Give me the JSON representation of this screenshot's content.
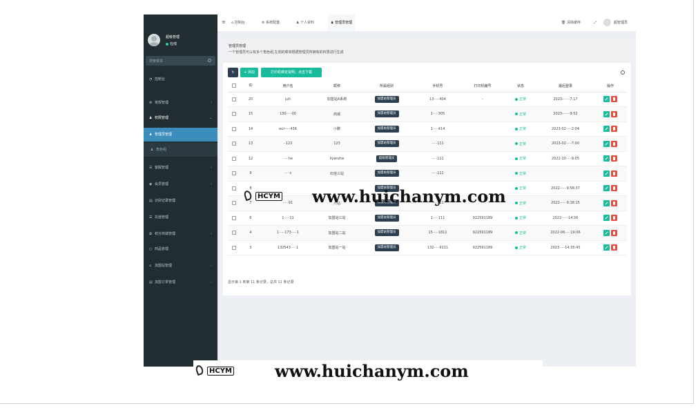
{
  "sidebar": {
    "user_name": "超级管理",
    "online": "在线",
    "search_placeholder": "搜索菜单",
    "items": [
      {
        "label": "控制台",
        "icon": "dashboard-icon",
        "expandable": false
      },
      {
        "label": "常规管理",
        "icon": "cogs-icon",
        "expandable": true
      },
      {
        "label": "权限管理",
        "icon": "group-icon",
        "expandable": true,
        "open": true
      },
      {
        "label": "管理员管理",
        "icon": "user-icon",
        "active": true
      },
      {
        "label": "角色组",
        "icon": "group-icon",
        "sub": true
      },
      {
        "label": "客服管理",
        "icon": "list-icon",
        "expandable": true
      },
      {
        "label": "会员管理",
        "icon": "user-circle-icon",
        "expandable": true
      },
      {
        "label": "识别记录管理",
        "icon": "list-alt-icon",
        "expandable": false
      },
      {
        "label": "充值管理",
        "icon": "list-icon",
        "expandable": false
      },
      {
        "label": "积分商城管理",
        "icon": "gift-icon",
        "expandable": true
      },
      {
        "label": "商品管理",
        "icon": "circle-icon",
        "expandable": false
      },
      {
        "label": "加盟站管理",
        "icon": "bank-icon",
        "expandable": true
      },
      {
        "label": "加盟订单管理",
        "icon": "list-alt-icon",
        "expandable": true
      }
    ]
  },
  "topbar": {
    "tabs": [
      "控制台",
      "系统配置",
      "个人资料",
      "管理员管理"
    ],
    "clear_cache": "清除缓存",
    "admin_name": "超管理员"
  },
  "content": {
    "title": "管理员管理",
    "description": "一个管理员可以有多个角色组,左侧的菜单根据管理员所拥有的权限进行生成",
    "btn_add": "添加",
    "btn_print": "打印机绑定说明，点击下载",
    "columns": [
      "ID",
      "用户名",
      "昵称",
      "所属组别",
      "手机号",
      "打印机编号",
      "状态",
      "最后登录",
      "操作"
    ],
    "rows": [
      {
        "id": "20",
        "username": "juh",
        "nickname": "加盟站A系统",
        "group": "加盟站管理员",
        "phone": "13·····404",
        "printer": "-",
        "status": "正常",
        "last_login": "2023-······7:17"
      },
      {
        "id": "15",
        "username": "130·····00",
        "nickname": "商城",
        "group": "加盟站管理员",
        "phone": "1·····305",
        "printer": "",
        "status": "正常",
        "last_login": "2023-······9:52"
      },
      {
        "id": "14",
        "username": "eur·····436",
        "nickname": "小鹏",
        "group": "加盟站管理员",
        "phone": "1·····414",
        "printer": "",
        "status": "正常",
        "last_login": "2023-02·····2:04"
      },
      {
        "id": "13",
        "username": "··123",
        "nickname": "123",
        "group": "加盟站管理员",
        "phone": "·····111",
        "printer": "",
        "status": "正常",
        "last_login": "2023-02·····7:00"
      },
      {
        "id": "12",
        "username": "·····he",
        "nickname": "liyanzhe",
        "group": "超级管理员",
        "phone": "·····111",
        "printer": "",
        "status": "正常",
        "last_login": "2022-10·····9:05"
      },
      {
        "id": "9",
        "username": "·····s",
        "nickname": "石佳三站",
        "group": "加盟站管理员",
        "phone": "·····111",
        "printer": "",
        "status": "正常",
        "last_login": ""
      },
      {
        "id": "8",
        "username": "",
        "nickname": "",
        "group": "加盟站管理员",
        "phone": "",
        "printer": "",
        "status": "正常",
        "last_login": "2022-·····9:58:37"
      },
      {
        "id": "7",
        "username": "·····91",
        "nickname": "六站",
        "group": "加盟站管理员",
        "phone": "·····111",
        "printer": "",
        "status": "正常",
        "last_login": "2022-·····9:18:15"
      },
      {
        "id": "6",
        "username": "1·····11",
        "nickname": "加盟站三站",
        "group": "加盟站管理员",
        "phone": "1·····111",
        "printer": "922591189",
        "status": "正常",
        "last_login": "2022-·····14:56"
      },
      {
        "id": "4",
        "username": "1·····173·····1",
        "nickname": "加盟站二站",
        "group": "加盟站管理员",
        "phone": "15·····1811",
        "printer": "922591189",
        "status": "正常",
        "last_login": "2022-06·····19:06"
      },
      {
        "id": "3",
        "username": "132543·····1",
        "nickname": "加盟站一站",
        "group": "加盟站管理员",
        "phone": "132·····9111",
        "printer": "922591189",
        "status": "正常",
        "last_login": "2023·····14:35:45"
      }
    ],
    "footer": "显示第 1 到第 11 条记录，总共 11 条记录"
  },
  "watermark": {
    "logo": "HCYM",
    "url": "www.huichanym.com"
  }
}
